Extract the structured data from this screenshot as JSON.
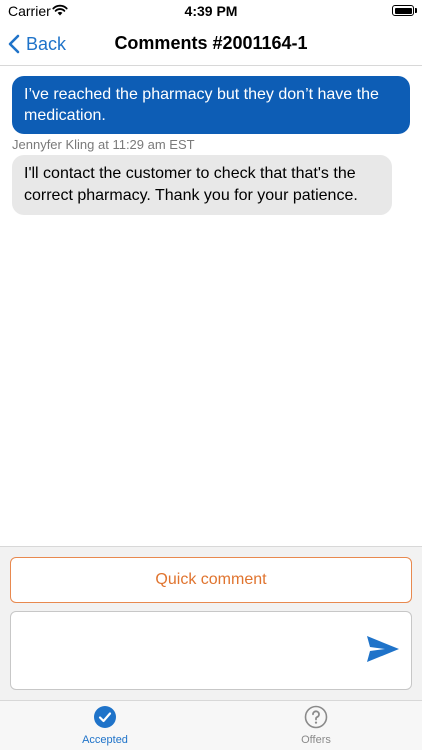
{
  "status_bar": {
    "carrier": "Carrier",
    "time": "4:39 PM"
  },
  "nav": {
    "back_label": "Back",
    "title": "Comments #2001164-1"
  },
  "messages": [
    {
      "direction": "outgoing",
      "text": "I’ve reached the pharmacy but they don’t have the medication."
    },
    {
      "direction": "incoming",
      "sender_line": "Jennyfer Kling at 11:29 am EST",
      "text": "I'll contact the customer to check that that's the correct pharmacy. Thank you for your patience."
    }
  ],
  "composer": {
    "quick_comment_label": "Quick comment",
    "comment_value": ""
  },
  "tabs": [
    {
      "label": "Accepted",
      "icon": "checkmark-circle-icon",
      "selected": true
    },
    {
      "label": "Offers",
      "icon": "question-circle-icon",
      "selected": false
    }
  ],
  "colors": {
    "accent": "#1f73c9",
    "outgoing_bubble": "#0d5db5",
    "incoming_bubble": "#e8e8e8",
    "quick_comment": "#e0742f"
  }
}
